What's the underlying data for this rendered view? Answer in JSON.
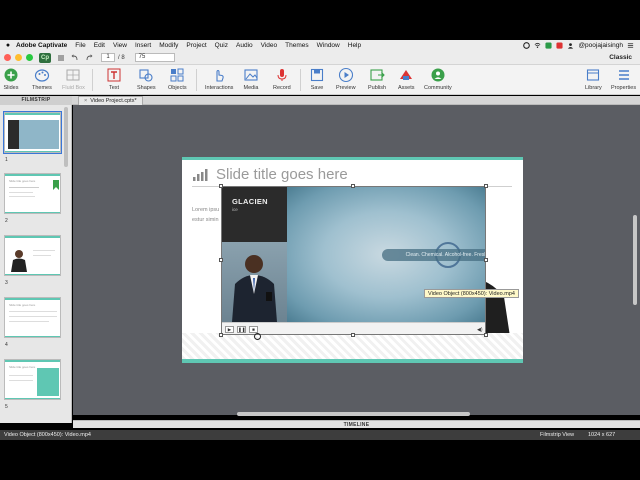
{
  "menubar": {
    "app_name": "Adobe Captivate",
    "items": [
      "File",
      "Edit",
      "View",
      "Insert",
      "Modify",
      "Project",
      "Quiz",
      "Audio",
      "Video",
      "Themes",
      "Window",
      "Help"
    ],
    "user": "@poojajaisingh"
  },
  "titlebar": {
    "logo": "Cp",
    "current_page": "1",
    "page_total": "/ 8",
    "zoom": "75",
    "workspace": "Classic"
  },
  "toolbar": {
    "slides": "Slides",
    "themes": "Themes",
    "fluid_box": "Fluid Box",
    "text": "Text",
    "shapes": "Shapes",
    "objects": "Objects",
    "interactions": "Interactions",
    "media": "Media",
    "record": "Record",
    "save": "Save",
    "preview": "Preview",
    "publish": "Publish",
    "assets": "Assets",
    "community": "Community",
    "library": "Library",
    "properties": "Properties"
  },
  "tabs": {
    "filmstrip_label": "FILMSTRIP",
    "doc_tab": "Video Project.cptx*",
    "close_glyph": "×"
  },
  "filmstrip": {
    "slides": [
      {
        "num": "1",
        "caption": ""
      },
      {
        "num": "2",
        "caption": "Slide title goes here"
      },
      {
        "num": "3",
        "caption": ""
      },
      {
        "num": "4",
        "caption": "Slide title goes here"
      },
      {
        "num": "5",
        "caption": "Slide title goes here"
      }
    ]
  },
  "slide": {
    "title": "Slide title goes here",
    "body_1": "Lorem ipsu",
    "body_2": "estur simin"
  },
  "video": {
    "brand": "GLACIEN",
    "brand_sub": "ice",
    "caption": "Clean. Chemical. Alcohol-free. Fresh.",
    "play": "▶",
    "pause": "❚❚",
    "stop": "■",
    "volume": "◀)"
  },
  "tooltip": "Video Object (800x450): Video.mp4",
  "timeline_label": "TIMELINE",
  "status": {
    "left": "Video Object (800x450): Video.mp4",
    "view": "Filmstrip View",
    "size": "1024 x 627"
  },
  "colors": {
    "accent_teal": "#5fc7b3",
    "stage_bg": "#5b5d63",
    "selection_blue": "#3a76d8"
  }
}
